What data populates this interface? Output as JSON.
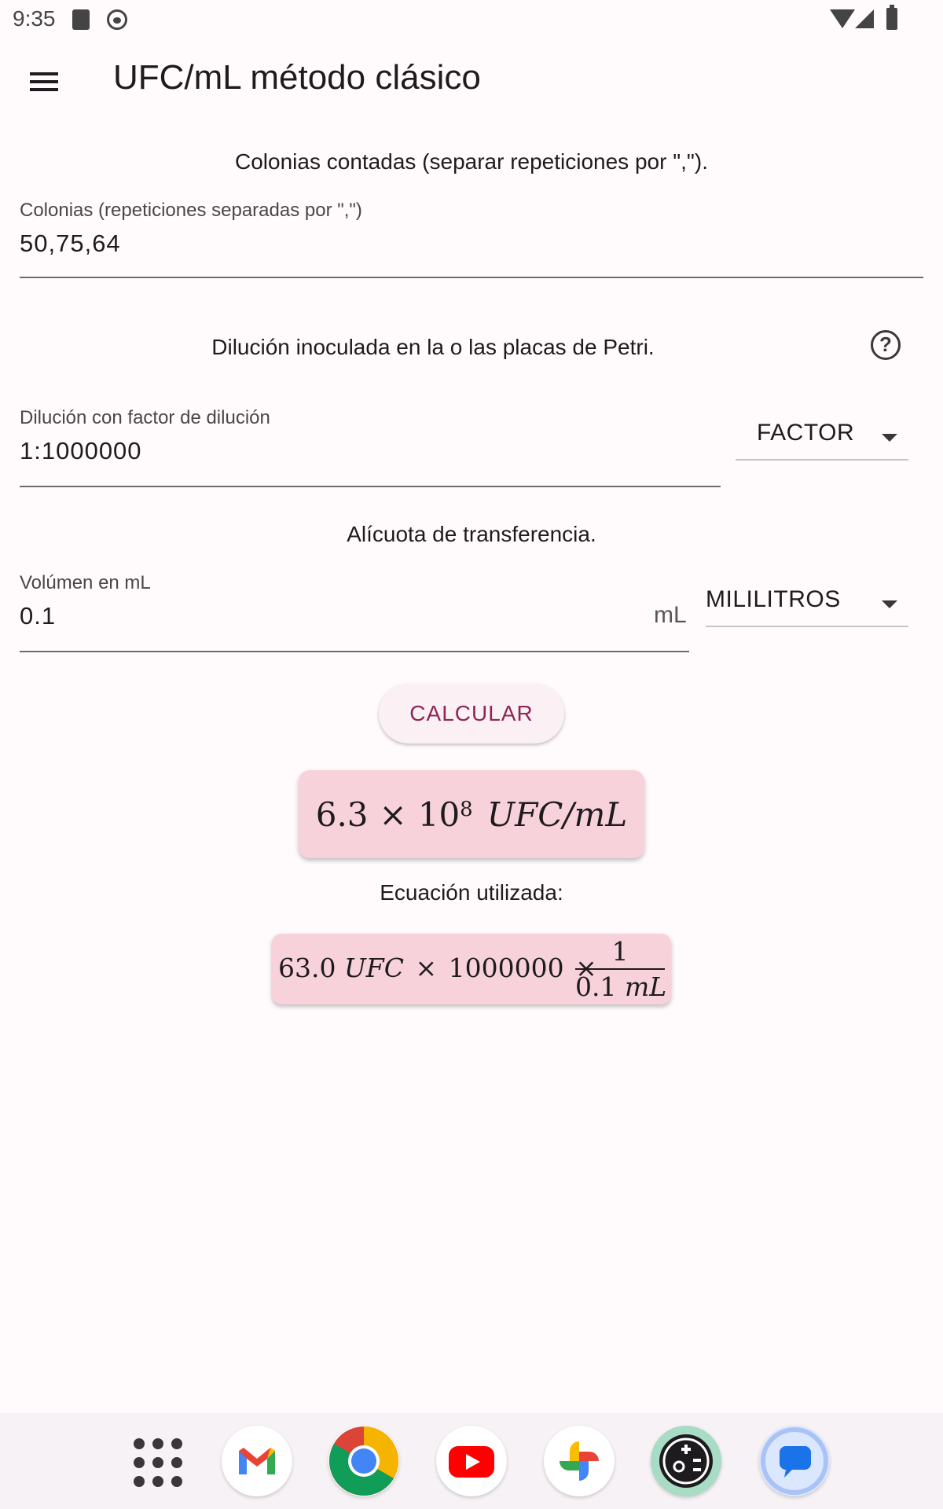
{
  "status_bar": {
    "time": "9:35"
  },
  "app_bar": {
    "title": "UFC/mL método clásico"
  },
  "colonies": {
    "section_label": "Colonias contadas (separar repeticiones por \",\").",
    "field_label": "Colonias (repeticiones separadas por \",\")",
    "value": "50,75,64"
  },
  "dilution": {
    "section_label": "Dilución inoculada en la o las placas de Petri.",
    "field_label": "Dilución con factor de dilución",
    "value": "1:1000000",
    "selected_option": "FACTOR"
  },
  "aliquot": {
    "section_label": "Alícuota de transferencia.",
    "field_label": "Volúmen en mL",
    "value": "0.1",
    "suffix": "mL",
    "selected_option": "MILILITROS"
  },
  "calculate_button": {
    "label": "CALCULAR"
  },
  "result": {
    "mantissa": "6.3",
    "times": "×",
    "base": "10",
    "exponent": "8",
    "unit": "UFC/mL"
  },
  "equation": {
    "label": "Ecuación utilizada:",
    "mean_colonies": "63.0",
    "colony_unit": "UFC",
    "times": "×",
    "dilution_factor": "1000000",
    "numerator": "1",
    "denominator": "0.1",
    "volume_unit": "mL"
  },
  "dock": {
    "apps": [
      "app-drawer",
      "gmail",
      "chrome",
      "youtube",
      "photos",
      "settings-app",
      "messages"
    ]
  }
}
